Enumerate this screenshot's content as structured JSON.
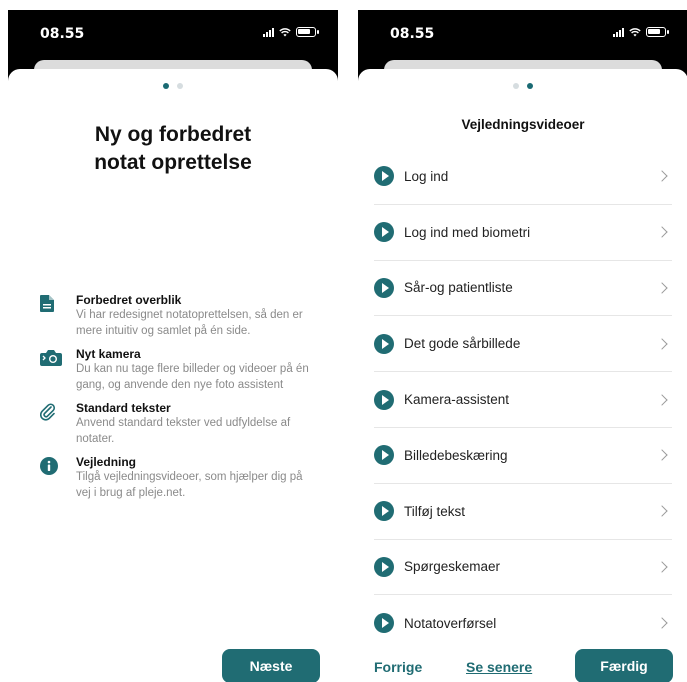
{
  "status_bar": {
    "time": "08.55"
  },
  "intro": {
    "title_line1": "Ny og forbedret",
    "title_line2": "notat oprettelse",
    "features": [
      {
        "icon": "document-icon",
        "title": "Forbedret overblik",
        "description": "Vi har redesignet notatoprettelsen, så den er mere intuitiv og samlet på én side."
      },
      {
        "icon": "camera-icon",
        "title": "Nyt kamera",
        "description": "Du kan nu tage flere billeder og videoer på én gang, og anvende den nye foto assistent"
      },
      {
        "icon": "paperclip-icon",
        "title": "Standard tekster",
        "description": "Anvend standard tekster ved udfyldelse af notater."
      },
      {
        "icon": "info-icon",
        "title": "Vejledning",
        "description": "Tilgå vejledningsvideoer, som hjælper dig på vej i brug af pleje.net."
      }
    ],
    "next_label": "Næste"
  },
  "videos": {
    "title": "Vejledningsvideoer",
    "items": [
      {
        "label": "Log ind"
      },
      {
        "label": "Log ind med biometri"
      },
      {
        "label": "Sår-og patientliste"
      },
      {
        "label": "Det gode sårbillede"
      },
      {
        "label": "Kamera-assistent"
      },
      {
        "label": "Billedebeskæring"
      },
      {
        "label": "Tilføj tekst"
      },
      {
        "label": "Spørgeskemaer"
      },
      {
        "label": "Notatoverførsel"
      }
    ],
    "prev_label": "Forrige",
    "later_label": "Se senere",
    "done_label": "Færdig"
  },
  "colors": {
    "accent": "#206c73",
    "dot_active": "#1a6a73",
    "dot_inactive": "#d6dde0"
  }
}
